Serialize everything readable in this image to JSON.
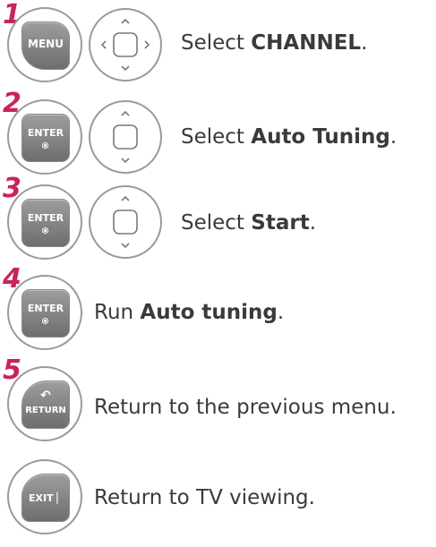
{
  "steps": [
    {
      "number": "1",
      "key_icon": "menu-key",
      "key_label": "MENU",
      "nav_icon": "four-way-dpad",
      "text_prefix": "Select ",
      "text_bold": "CHANNEL",
      "text_suffix": "."
    },
    {
      "number": "2",
      "key_icon": "enter-key",
      "key_label": "ENTER",
      "nav_icon": "up-down-dpad",
      "text_prefix": "Select ",
      "text_bold": "Auto Tuning",
      "text_suffix": "."
    },
    {
      "number": "3",
      "key_icon": "enter-key",
      "key_label": "ENTER",
      "nav_icon": "up-down-dpad",
      "text_prefix": "Select ",
      "text_bold": "Start",
      "text_suffix": "."
    },
    {
      "number": "4",
      "key_icon": "enter-key",
      "key_label": "ENTER",
      "text_prefix": "Run ",
      "text_bold": "Auto tuning",
      "text_suffix": "."
    },
    {
      "number": "5",
      "key_icon": "return-key",
      "key_label": "RETURN",
      "text_prefix": "Return to the previous menu.",
      "text_bold": "",
      "text_suffix": ""
    },
    {
      "key_icon": "exit-key",
      "key_label": "EXIT",
      "text_prefix": "Return to TV viewing.",
      "text_bold": "",
      "text_suffix": ""
    }
  ],
  "colors": {
    "step_number": "#c8245a",
    "key_face": "#7f7f7f",
    "ring": "#9a9a9a",
    "text": "#3a3a3a"
  }
}
